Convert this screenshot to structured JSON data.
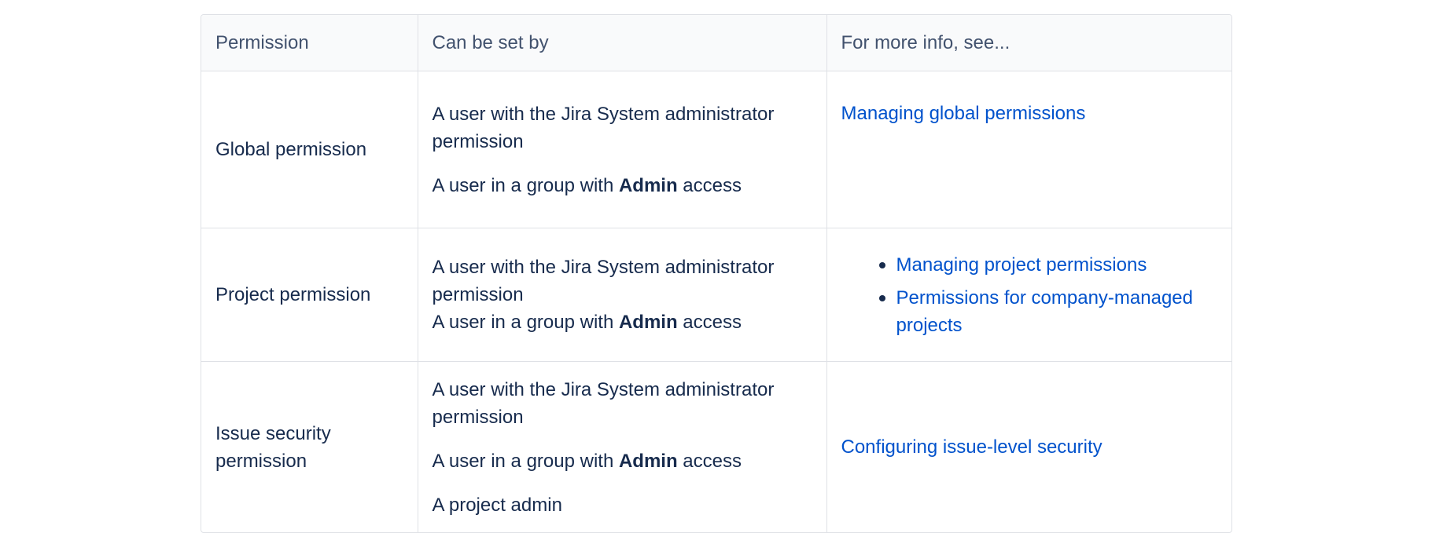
{
  "table": {
    "headers": [
      "Permission",
      "Can be set by",
      "For more info, see..."
    ],
    "rows": [
      {
        "permission": "Global permission",
        "set_by": [
          {
            "pre": "A user with the Jira System administrator permission",
            "bold": "",
            "post": ""
          },
          {
            "pre": "A user in a group with ",
            "bold": "Admin",
            "post": " access"
          }
        ],
        "info": [
          "Managing global permissions"
        ]
      },
      {
        "permission": "Project permission",
        "set_by": [
          {
            "pre": "A user with the Jira System administrator permission",
            "bold": "",
            "post": ""
          },
          {
            "pre": "A user in a group with ",
            "bold": "Admin",
            "post": " access"
          }
        ],
        "info": [
          "Managing project permissions",
          "Permissions for company-managed projects"
        ]
      },
      {
        "permission": "Issue security permission",
        "set_by": [
          {
            "pre": "A user with the Jira System administrator permission",
            "bold": "",
            "post": ""
          },
          {
            "pre": "A user in a group with ",
            "bold": "Admin",
            "post": " access"
          },
          {
            "pre": "A project admin",
            "bold": "",
            "post": ""
          }
        ],
        "info": [
          "Configuring issue-level security"
        ]
      }
    ]
  },
  "colors": {
    "link": "#0052cc",
    "text": "#172b4d",
    "header_text": "#42526e",
    "header_bg": "#f9fafb",
    "border": "#dfe1e6"
  }
}
